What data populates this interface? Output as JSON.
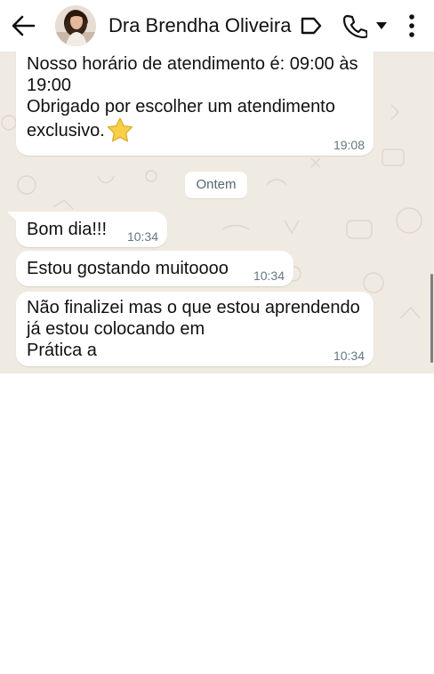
{
  "header": {
    "back_icon": "arrow-left-icon",
    "contact_name": "Dra Brendha Oliveira",
    "icons": [
      "label-icon",
      "phone-icon",
      "caret-down-icon",
      "more-vert-icon"
    ]
  },
  "messages": [
    {
      "text": "Nosso horário de atendimento é: 09:00 às\n19:00\nObrigado por escolher um atendimento\nexclusivo.",
      "emoji": "star-icon",
      "time": "19:08"
    },
    {
      "text": "Bom dia!!!",
      "time": "10:34"
    },
    {
      "text": "Estou gostando muitoooo",
      "time": "10:34"
    },
    {
      "text": "Não finalizei mas o que estou aprendendo\njá estou colocando em\nPrática a",
      "time": "10:34"
    }
  ],
  "date_separator": "Ontem",
  "colors": {
    "chat_background": "#efeae2",
    "bubble": "#ffffff",
    "time": "#667781",
    "header": "#ffffff"
  }
}
